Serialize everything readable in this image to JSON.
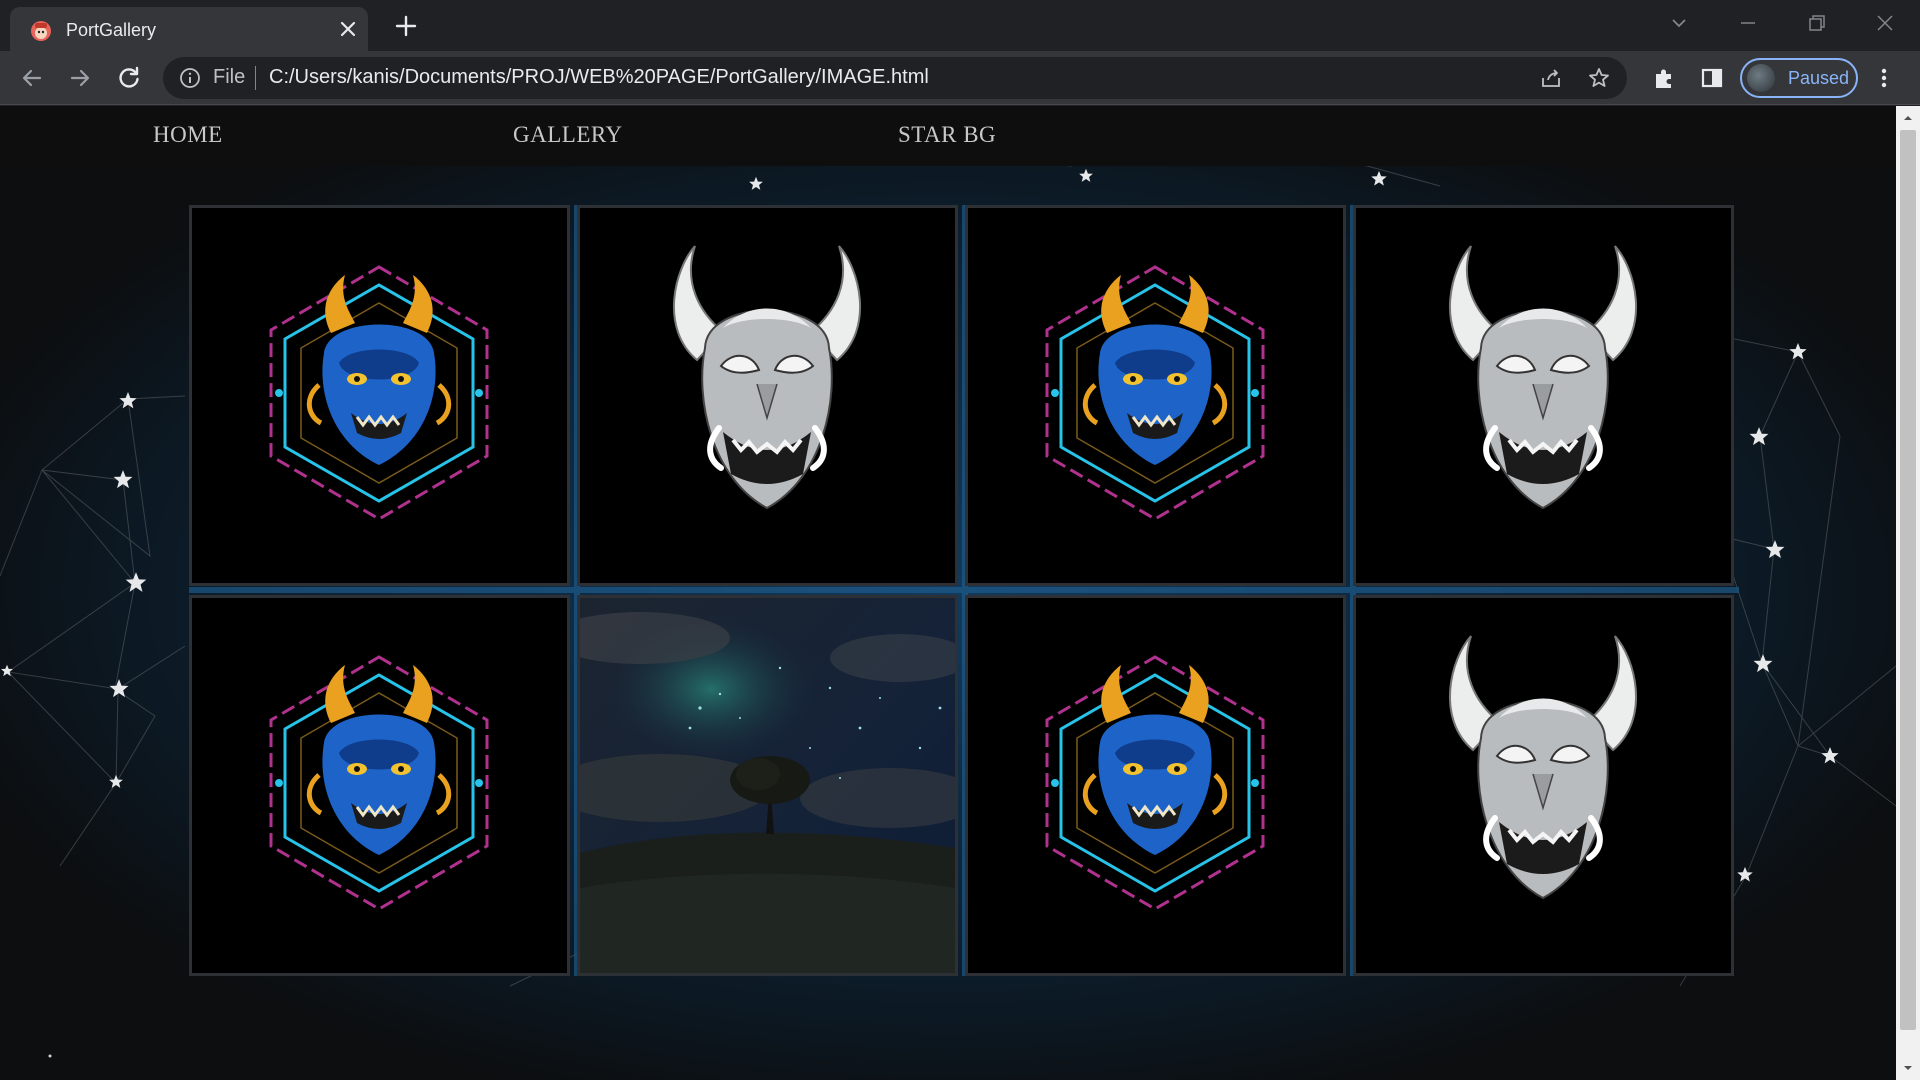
{
  "browser": {
    "tab_title": "PortGallery",
    "omnibox": {
      "scheme_label": "File",
      "url": "C:/Users/kanis/Documents/PROJ/WEB%20PAGE/PortGallery/IMAGE.html"
    },
    "profile_label": "Paused"
  },
  "page": {
    "nav": [
      {
        "label": "HOME"
      },
      {
        "label": "GALLERY"
      },
      {
        "label": "STAR BG"
      }
    ],
    "gallery": {
      "tiles": [
        {
          "image": "blue-oni-mask-hexagon"
        },
        {
          "image": "white-oni-mask"
        },
        {
          "image": "blue-oni-mask-hexagon"
        },
        {
          "image": "white-oni-mask"
        },
        {
          "image": "blue-oni-mask-hexagon"
        },
        {
          "image": "starry-night-tree"
        },
        {
          "image": "blue-oni-mask-hexagon"
        },
        {
          "image": "white-oni-mask"
        }
      ]
    }
  },
  "colors": {
    "nav_text": "#c8c8c8",
    "tile_border": "#2d3034",
    "accent_profile": "#8ab4f8",
    "grid_glow": "#1d5a8a"
  }
}
